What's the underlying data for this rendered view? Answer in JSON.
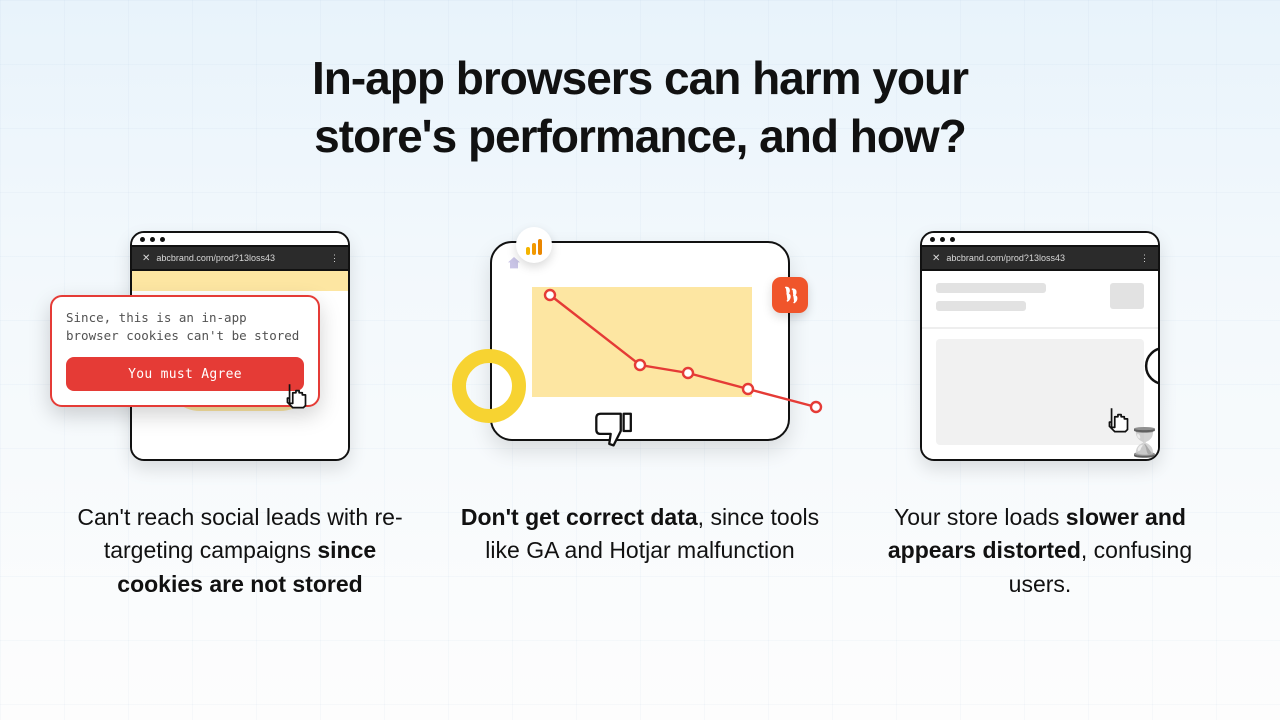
{
  "title": {
    "line1": "In-app browsers can harm your",
    "line2": "store's performance, and how?"
  },
  "col1": {
    "url": "abcbrand.com/prod?13loss43",
    "modal_text": "Since, this is an in-app browser cookies can't be stored",
    "button_label": "You must Agree",
    "caption_a": "Can't reach social leads with re-targeting campaigns ",
    "caption_b": "since cookies are not stored"
  },
  "col2": {
    "caption_a": "Don't get correct data",
    "caption_b": ", since tools like GA and Hotjar malfunction"
  },
  "col3": {
    "url": "abcbrand.com/prod?13loss43",
    "caption_a": "Your store loads ",
    "caption_b": "slower and appears distorted",
    "caption_c": ", confusing users."
  },
  "chart_data": {
    "type": "line",
    "title": "",
    "xlabel": "",
    "ylabel": "",
    "x": [
      0,
      1,
      2,
      3,
      4
    ],
    "values": [
      95,
      48,
      42,
      32,
      20
    ],
    "ylim": [
      0,
      100
    ],
    "note": "illustrative downward trend; values estimated from graphic"
  }
}
